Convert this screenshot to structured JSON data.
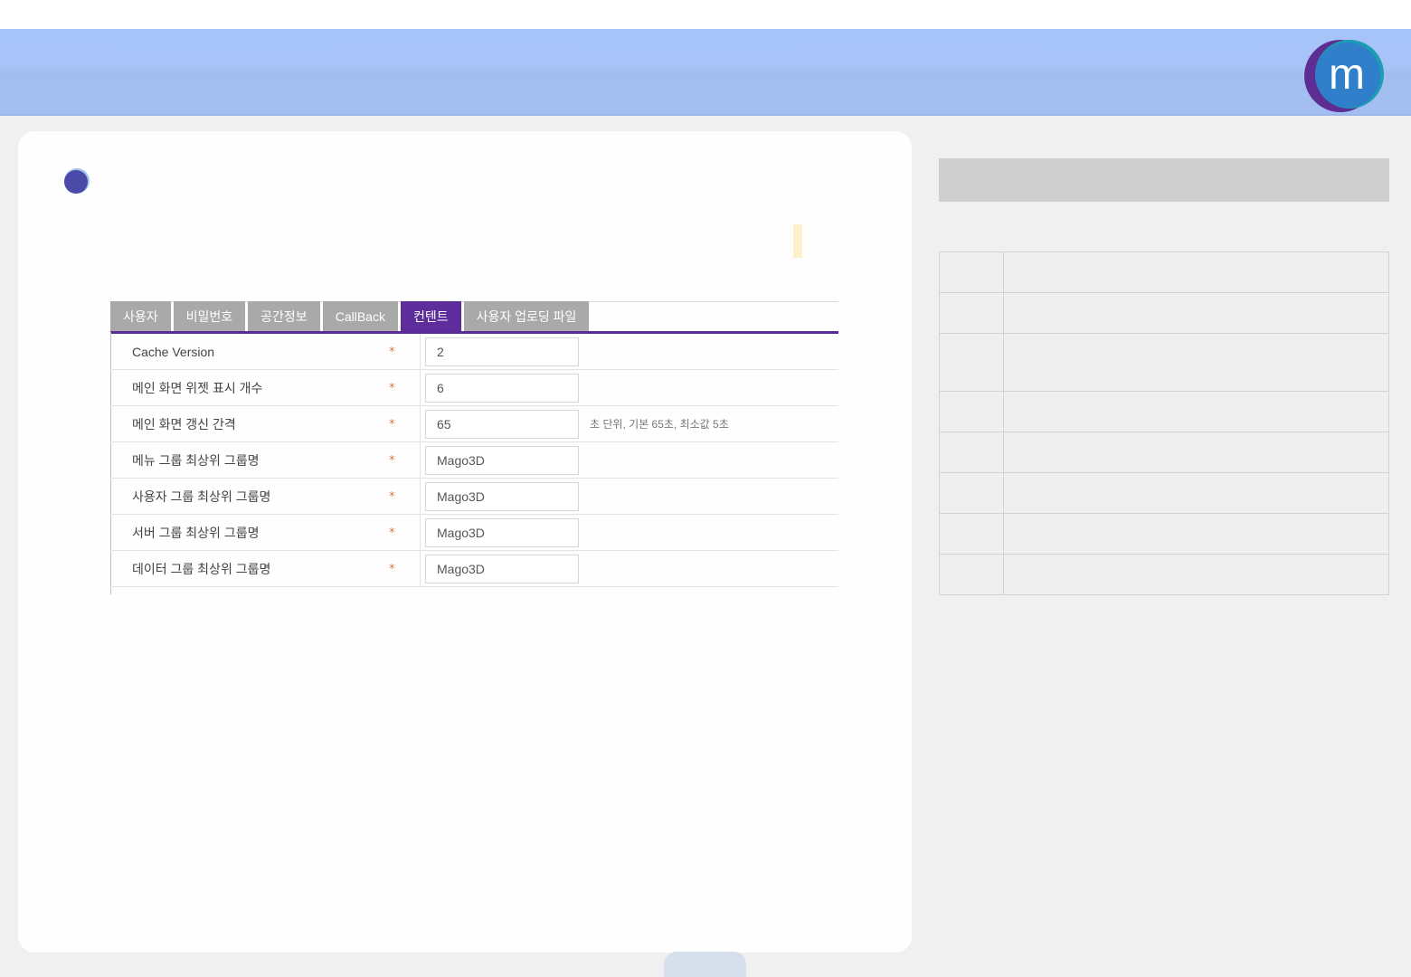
{
  "logo": {
    "letter": "m",
    "colors": {
      "left": "#5c2d92",
      "main": "#2f7fcb",
      "ring": "#1c9db1"
    }
  },
  "config_screen": {
    "tabs": [
      {
        "label": "사용자",
        "active": false
      },
      {
        "label": "비밀번호",
        "active": false
      },
      {
        "label": "공간정보",
        "active": false
      },
      {
        "label": "CallBack",
        "active": false
      },
      {
        "label": "컨텐트",
        "active": true
      },
      {
        "label": "사용자 업로딩 파일",
        "active": false
      }
    ],
    "required_marker": "*",
    "fields": [
      {
        "label": "Cache Version",
        "value": "2",
        "hint": ""
      },
      {
        "label": "메인 화면 위젯 표시 개수",
        "value": "6",
        "hint": ""
      },
      {
        "label": "메인 화면 갱신 간격",
        "value": "65",
        "hint": "초 단위, 기본 65초, 최소값 5초"
      },
      {
        "label": "메뉴 그룹 최상위 그룹명",
        "value": "Mago3D",
        "hint": ""
      },
      {
        "label": "사용자 그룹 최상위 그룹명",
        "value": "Mago3D",
        "hint": ""
      },
      {
        "label": "서버 그룹 최상위 그룹명",
        "value": "Mago3D",
        "hint": ""
      },
      {
        "label": "데이터 그룹 최상위 그룹명",
        "value": "Mago3D",
        "hint": ""
      }
    ]
  },
  "side_panel": {
    "rows": 8
  },
  "colors": {
    "header": "#a6c2f6",
    "active_tab": "#5d2d9c",
    "required": "#e2763a"
  }
}
